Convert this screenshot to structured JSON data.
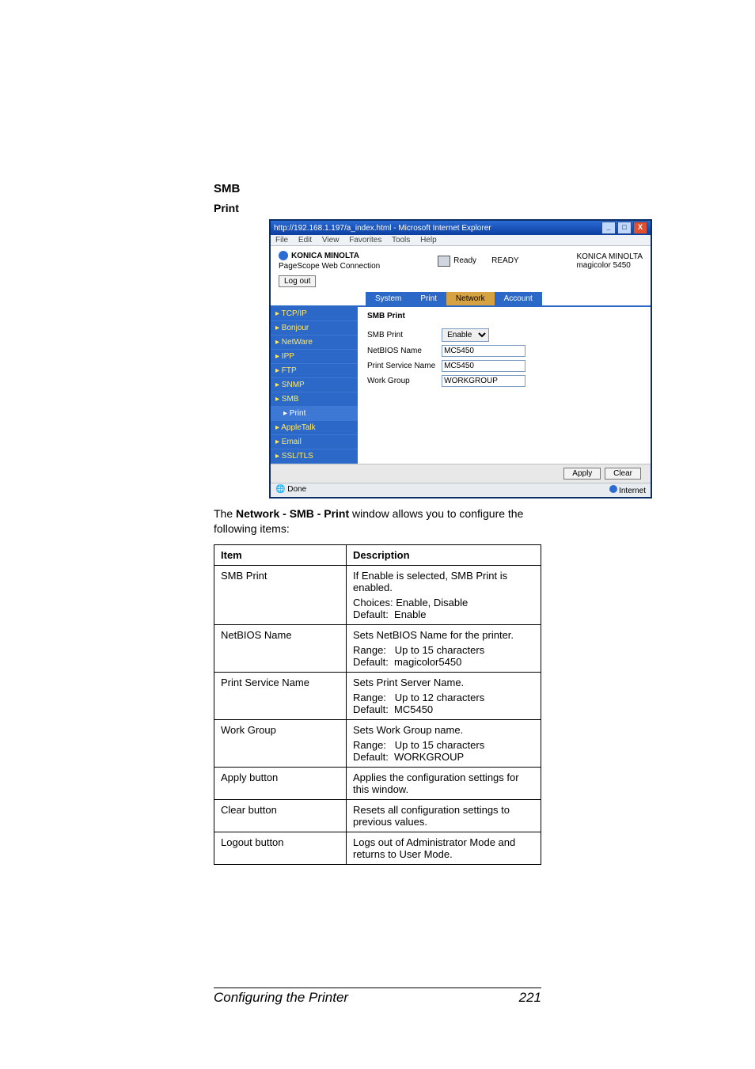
{
  "headings": {
    "smb": "SMB",
    "print": "Print"
  },
  "shot": {
    "title": "http://192.168.1.197/a_index.html - Microsoft Internet Explorer",
    "menu": [
      "File",
      "Edit",
      "View",
      "Favorites",
      "Tools",
      "Help"
    ],
    "brand": "KONICA MINOLTA",
    "connection": "PageScope Web Connection",
    "ready_label": "Ready",
    "ready_status": "READY",
    "right_brand": "KONICA MINOLTA",
    "right_model": "magicolor 5450",
    "logout": "Log out",
    "tabs": [
      "System",
      "Print",
      "Network",
      "Account"
    ],
    "active_tab": 2,
    "sidebar": [
      {
        "label": "▸ TCP/IP"
      },
      {
        "label": "▸ Bonjour"
      },
      {
        "label": "▸ NetWare"
      },
      {
        "label": "▸ IPP"
      },
      {
        "label": "▸ FTP"
      },
      {
        "label": "▸ SNMP"
      },
      {
        "label": "▸ SMB",
        "smb": true
      },
      {
        "label": "▸ Print",
        "sub": true
      },
      {
        "label": "▸ AppleTalk"
      },
      {
        "label": "▸ Email"
      },
      {
        "label": "▸ SSL/TLS"
      }
    ],
    "panel_title": "SMB Print",
    "fields": {
      "smb_print_label": "SMB Print",
      "smb_print_value": "Enable",
      "netbios_label": "NetBIOS Name",
      "netbios_value": "MC5450",
      "service_label": "Print Service Name",
      "service_value": "MC5450",
      "workgroup_label": "Work Group",
      "workgroup_value": "WORKGROUP"
    },
    "apply": "Apply",
    "clear": "Clear",
    "status_done": "Done",
    "status_zone": "Internet"
  },
  "caption_prefix": "The ",
  "caption_bold": "Network - SMB - Print",
  "caption_suffix": " window allows you to configure the following items:",
  "table": {
    "h1": "Item",
    "h2": "Description",
    "rows": [
      {
        "item": "SMB Print",
        "d1": "If Enable is selected, SMB Print is enabled.",
        "d2": "Choices: Enable, Disable\nDefault:  Enable"
      },
      {
        "item": "NetBIOS Name",
        "d1": "Sets NetBIOS Name for the printer.",
        "d2": "Range:   Up to 15 characters\nDefault:  magicolor5450"
      },
      {
        "item": "Print Service Name",
        "d1": "Sets Print Server Name.",
        "d2": "Range:   Up to 12 characters\nDefault:  MC5450"
      },
      {
        "item": "Work Group",
        "d1": "Sets Work Group name.",
        "d2": "Range:   Up to 15 characters\nDefault:  WORKGROUP"
      },
      {
        "item": "Apply button",
        "d1": "Applies the configuration settings for this window."
      },
      {
        "item": "Clear button",
        "d1": "Resets all configuration settings to previous values."
      },
      {
        "item": "Logout button",
        "d1": "Logs out of Administrator Mode and returns to User Mode."
      }
    ]
  },
  "footer": {
    "left": "Configuring the Printer",
    "right": "221"
  }
}
